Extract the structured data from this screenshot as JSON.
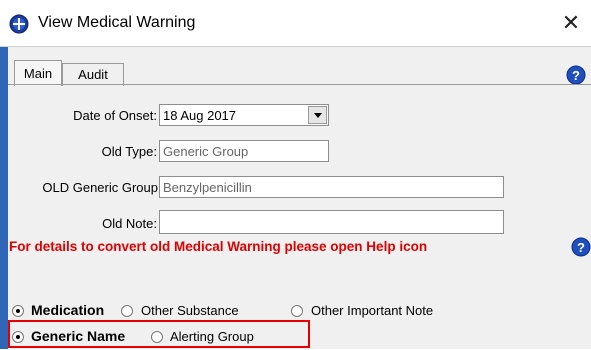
{
  "window": {
    "title": "View Medical Warning",
    "close_glyph": "✕",
    "app_icon": "globe-icon"
  },
  "tabs": [
    {
      "label": "Main",
      "active": true
    },
    {
      "label": "Audit",
      "active": false
    }
  ],
  "help_icon": "help-icon",
  "form": {
    "date_of_onset": {
      "label": "Date of Onset:",
      "value": "18 Aug 2017"
    },
    "old_type": {
      "label": "Old Type:",
      "value": "Generic Group"
    },
    "old_generic_group": {
      "label": "OLD Generic Group",
      "value": "Benzylpenicillin"
    },
    "old_note": {
      "label": "Old Note:",
      "value": ""
    }
  },
  "warning_text": "For details to convert old Medical Warning please open Help icon",
  "radio_row1": [
    {
      "label": "Medication",
      "checked": true,
      "bold": true
    },
    {
      "label": "Other Substance",
      "checked": false,
      "bold": false
    },
    {
      "label": "Other Important Note",
      "checked": false,
      "bold": false
    }
  ],
  "radio_row2": [
    {
      "label": "Generic Name",
      "checked": true,
      "bold": true
    },
    {
      "label": "Alerting Group",
      "checked": false,
      "bold": false
    }
  ],
  "colors": {
    "warning": "#e00000",
    "highlight_box": "#e60000",
    "help_blue": "#1f4fbf"
  }
}
